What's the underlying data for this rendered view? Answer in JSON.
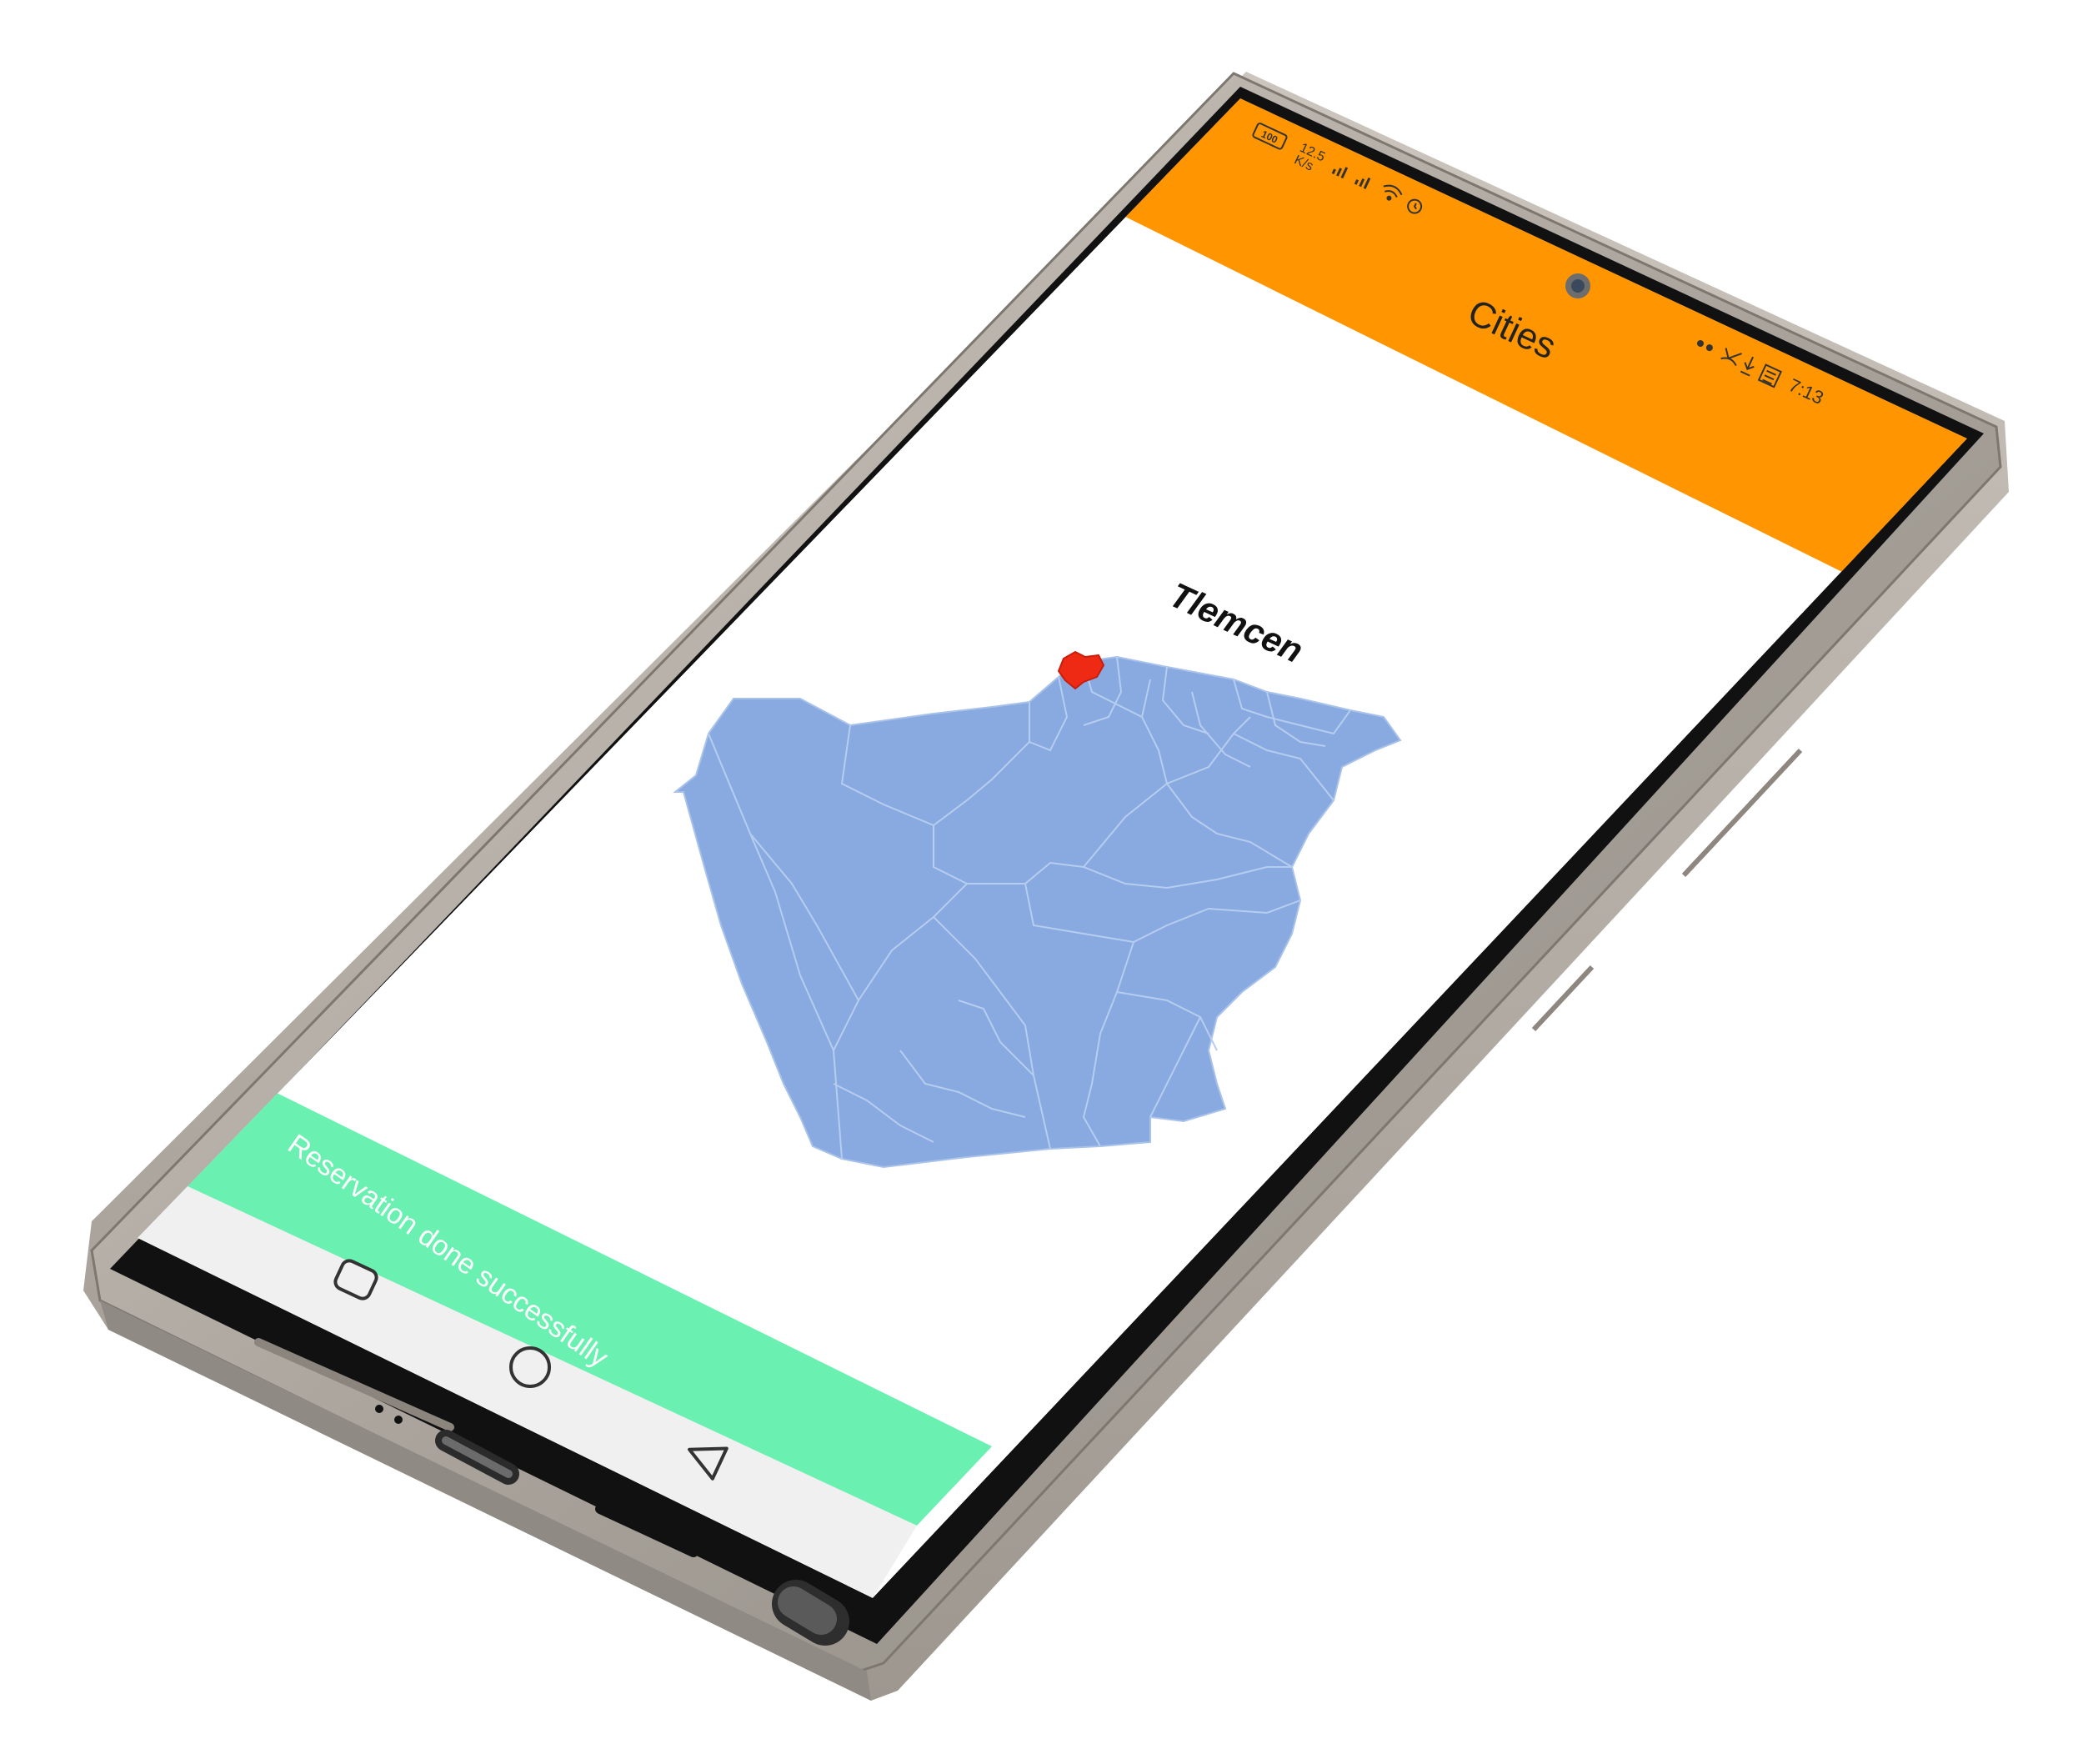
{
  "status_bar": {
    "battery": "100",
    "net_speed_value": "12.5",
    "net_speed_unit": "K/s",
    "time": "7:13"
  },
  "app_bar": {
    "title": "Cities"
  },
  "map": {
    "selected_city": "Tlemcen"
  },
  "snackbar": {
    "message": "Reservation done successfully"
  },
  "colors": {
    "app_bar": "#ff9500",
    "map_region": "#88aae0",
    "map_selected": "#ee2a14",
    "snackbar": "#6af0b0",
    "nav_bar": "#f0f0f0",
    "frame": "#b5afa7"
  },
  "nav_bar": {
    "icons": [
      "recents-icon",
      "home-icon",
      "back-icon"
    ]
  },
  "status_icons": [
    "signal-icon",
    "wifi-icon",
    "alarm-icon",
    "dots-icon",
    "missed-call-icon",
    "download-icon",
    "notification-icon"
  ]
}
